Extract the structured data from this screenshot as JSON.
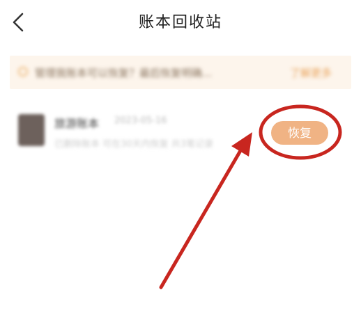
{
  "header": {
    "title": "账本回收站",
    "back_icon": "chevron-left-icon"
  },
  "banner": {
    "icon": "info-circle-icon",
    "text": "管理我账本可以恢复？最后恢复明确...",
    "link_label": "了解更多"
  },
  "record": {
    "name": "旅游账本",
    "date": "2023-05-16",
    "desc": "已删除账本 可在30天内恢复 共3笔记录"
  },
  "restore_button": {
    "label": "恢复"
  },
  "colors": {
    "accent": "#f0b384",
    "banner_bg": "#fdf5ec",
    "annotation": "#c8261f"
  }
}
